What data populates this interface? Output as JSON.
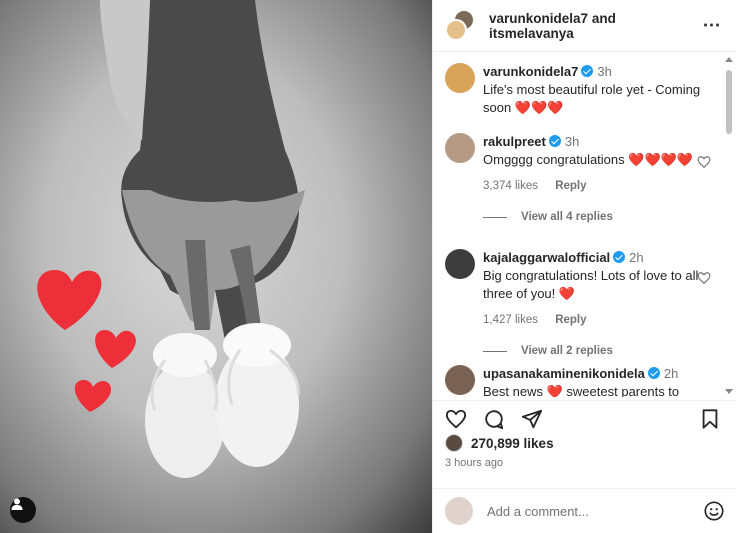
{
  "post": {
    "header_user1": "varunkonidela7",
    "header_and": "and",
    "header_user2": "itsmelavanya",
    "more_icon": "⋯"
  },
  "caption": {
    "username": "varunkonidela7",
    "time": "3h",
    "text": "Life's most beautiful role yet - Coming soon",
    "hearts": "❤️❤️❤️"
  },
  "comments": [
    {
      "username": "rakulpreet",
      "time": "3h",
      "text": "Omgggg congratulations",
      "hearts": "❤️❤️❤️❤️",
      "likes": "3,374 likes",
      "reply": "Reply",
      "view_replies": "View all 4 replies"
    },
    {
      "username": "kajalaggarwalofficial",
      "time": "2h",
      "text": "Big congratulations! Lots of love to all three of you!",
      "hearts": "❤️",
      "likes": "1,427 likes",
      "reply": "Reply",
      "view_replies": "View all 2 replies"
    },
    {
      "username": "upasanakaminenikonidela",
      "time": "2h",
      "text": "Best news",
      "text2": "sweetest parents to",
      "hearts": "❤️"
    }
  ],
  "footer": {
    "likes_count": "270,899 likes",
    "time_ago": "3 hours ago",
    "add_comment_placeholder": "Add a comment..."
  },
  "colors": {
    "heart": "#ed2f3a",
    "verified": "#1d9bf0",
    "muted": "#737373"
  }
}
